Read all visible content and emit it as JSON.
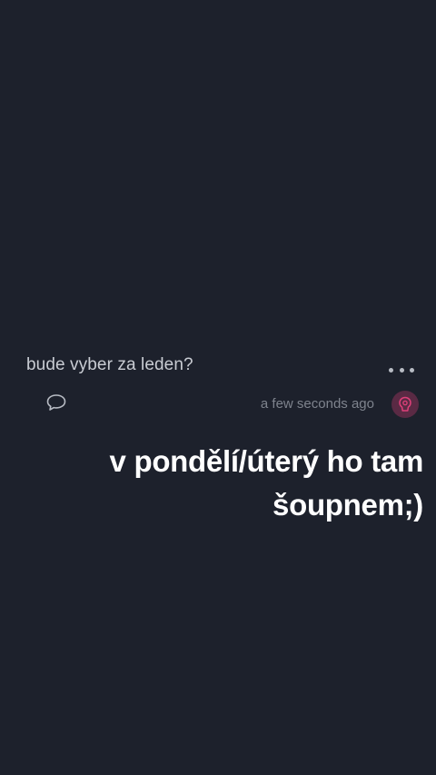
{
  "comment": {
    "question": "bude vyber za leden?",
    "timestamp": "a few seconds ago",
    "more_icon": "more-dots-icon",
    "reply_icon": "speech-bubble-icon",
    "avatar_icon": "avatar-icon"
  },
  "caption": {
    "line1": "v pondělí/úterý ho tam",
    "line2": "šoupnem;)"
  },
  "colors": {
    "background": "#1d212c",
    "text": "#c9ccd3",
    "muted": "#7e838d",
    "avatar_bg": "#5a2a44",
    "avatar_accent": "#e0407a",
    "caption": "#ffffff"
  }
}
